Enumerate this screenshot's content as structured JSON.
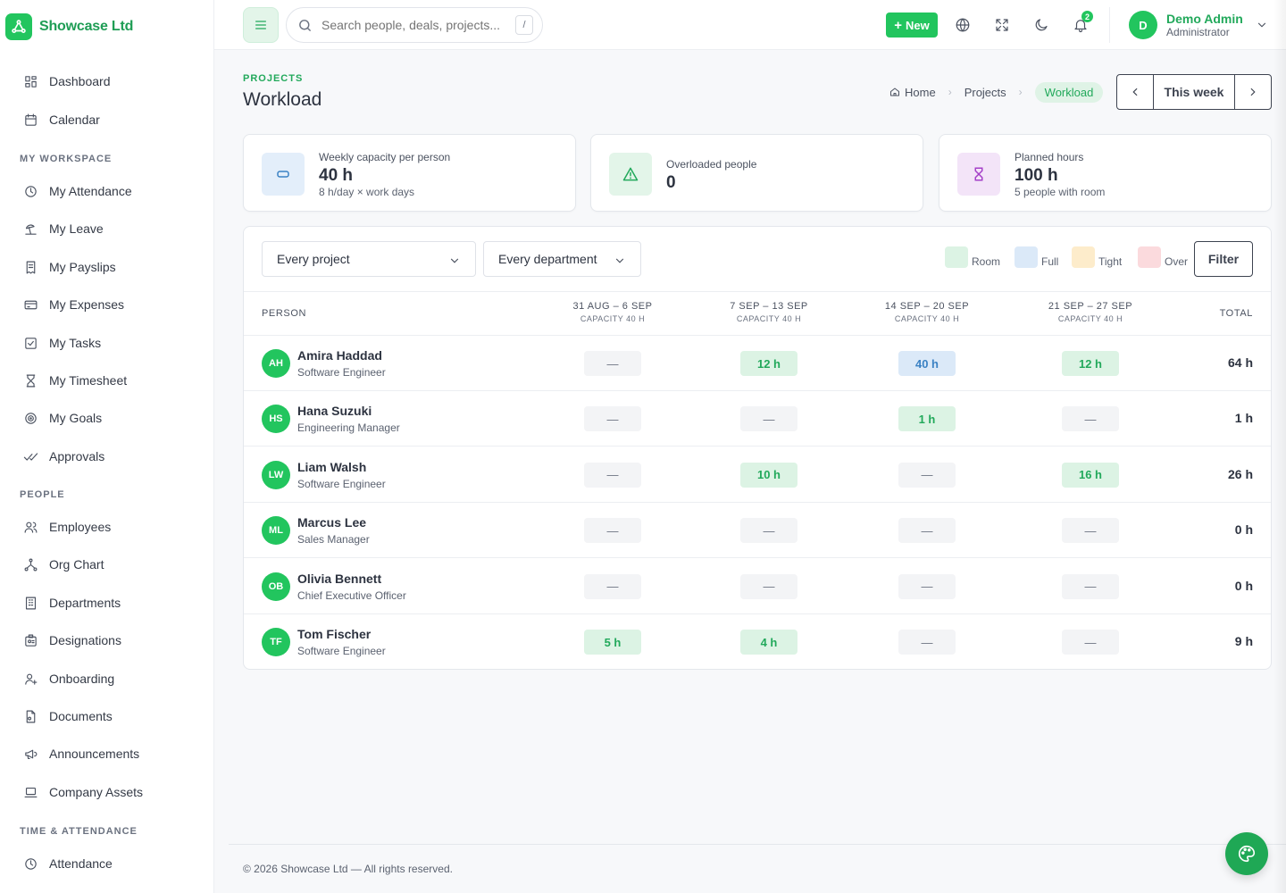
{
  "brand": {
    "name": "Showcase Ltd"
  },
  "sidebar": {
    "top_items": [
      {
        "label": "Dashboard",
        "icon": "dashboard-icon"
      },
      {
        "label": "Calendar",
        "icon": "calendar-icon"
      }
    ],
    "sections": [
      {
        "title": "MY WORKSPACE",
        "items": [
          {
            "label": "My Attendance",
            "icon": "clock-icon"
          },
          {
            "label": "My Leave",
            "icon": "beach-icon"
          },
          {
            "label": "My Payslips",
            "icon": "receipt-icon"
          },
          {
            "label": "My Expenses",
            "icon": "card-icon"
          },
          {
            "label": "My Tasks",
            "icon": "checkbox-icon"
          },
          {
            "label": "My Timesheet",
            "icon": "hourglass-icon"
          },
          {
            "label": "My Goals",
            "icon": "target-icon"
          },
          {
            "label": "Approvals",
            "icon": "double-check-icon"
          }
        ]
      },
      {
        "title": "PEOPLE",
        "items": [
          {
            "label": "Employees",
            "icon": "users-icon"
          },
          {
            "label": "Org Chart",
            "icon": "org-chart-icon"
          },
          {
            "label": "Departments",
            "icon": "building-icon"
          },
          {
            "label": "Designations",
            "icon": "id-badge-icon"
          },
          {
            "label": "Onboarding",
            "icon": "user-plus-icon"
          },
          {
            "label": "Documents",
            "icon": "document-icon"
          },
          {
            "label": "Announcements",
            "icon": "megaphone-icon"
          },
          {
            "label": "Company Assets",
            "icon": "laptop-icon"
          }
        ]
      },
      {
        "title": "TIME & ATTENDANCE",
        "items": [
          {
            "label": "Attendance",
            "icon": "clock-icon"
          }
        ]
      }
    ]
  },
  "topbar": {
    "search_placeholder": "Search people, deals, projects...",
    "search_shortcut": "/",
    "new_label": "New",
    "notifications_count": "2",
    "user": {
      "initial": "D",
      "name": "Demo Admin",
      "role": "Administrator"
    }
  },
  "page": {
    "eyebrow": "PROJECTS",
    "title": "Workload",
    "breadcrumb": {
      "home": "Home",
      "projects": "Projects",
      "current": "Workload"
    },
    "period_label": "This week"
  },
  "stats": [
    {
      "label": "Weekly capacity per person",
      "value": "40 h",
      "sub": "8 h/day × work days",
      "icon": "capacity-icon",
      "bg": "#e3eefa",
      "color": "#3b82c4"
    },
    {
      "label": "Overloaded people",
      "value": "0",
      "sub": "",
      "icon": "warning-icon",
      "bg": "#e3f5e9",
      "color": "#22a95b"
    },
    {
      "label": "Planned hours",
      "value": "100 h",
      "sub": "5 people with room",
      "icon": "hourglass-icon",
      "bg": "#f3e4f8",
      "color": "#a43fc8"
    }
  ],
  "filters": {
    "project": "Every project",
    "department": "Every department",
    "filter_label": "Filter"
  },
  "legend": [
    {
      "label": "Room",
      "color": "#dcf3e4"
    },
    {
      "label": "Full",
      "color": "#dbe9f8"
    },
    {
      "label": "Tight",
      "color": "#fdeccb"
    },
    {
      "label": "Over",
      "color": "#fbdadd"
    }
  ],
  "table": {
    "person_header": "PERSON",
    "total_header": "TOTAL",
    "weeks": [
      {
        "range": "31 AUG – 6 SEP",
        "capacity": "CAPACITY 40 H"
      },
      {
        "range": "7 SEP – 13 SEP",
        "capacity": "CAPACITY 40 H"
      },
      {
        "range": "14 SEP – 20 SEP",
        "capacity": "CAPACITY 40 H"
      },
      {
        "range": "21 SEP – 27 SEP",
        "capacity": "CAPACITY 40 H"
      }
    ],
    "rows": [
      {
        "initials": "AH",
        "name": "Amira Haddad",
        "role": "Software Engineer",
        "cells": [
          {
            "text": "—",
            "state": "empty"
          },
          {
            "text": "12 h",
            "state": "room"
          },
          {
            "text": "40 h",
            "state": "full"
          },
          {
            "text": "12 h",
            "state": "room"
          }
        ],
        "total": "64 h"
      },
      {
        "initials": "HS",
        "name": "Hana Suzuki",
        "role": "Engineering Manager",
        "cells": [
          {
            "text": "—",
            "state": "empty"
          },
          {
            "text": "—",
            "state": "empty"
          },
          {
            "text": "1 h",
            "state": "room"
          },
          {
            "text": "—",
            "state": "empty"
          }
        ],
        "total": "1 h"
      },
      {
        "initials": "LW",
        "name": "Liam Walsh",
        "role": "Software Engineer",
        "cells": [
          {
            "text": "—",
            "state": "empty"
          },
          {
            "text": "10 h",
            "state": "room"
          },
          {
            "text": "—",
            "state": "empty"
          },
          {
            "text": "16 h",
            "state": "room"
          }
        ],
        "total": "26 h"
      },
      {
        "initials": "ML",
        "name": "Marcus Lee",
        "role": "Sales Manager",
        "cells": [
          {
            "text": "—",
            "state": "empty"
          },
          {
            "text": "—",
            "state": "empty"
          },
          {
            "text": "—",
            "state": "empty"
          },
          {
            "text": "—",
            "state": "empty"
          }
        ],
        "total": "0 h"
      },
      {
        "initials": "OB",
        "name": "Olivia Bennett",
        "role": "Chief Executive Officer",
        "cells": [
          {
            "text": "—",
            "state": "empty"
          },
          {
            "text": "—",
            "state": "empty"
          },
          {
            "text": "—",
            "state": "empty"
          },
          {
            "text": "—",
            "state": "empty"
          }
        ],
        "total": "0 h"
      },
      {
        "initials": "TF",
        "name": "Tom Fischer",
        "role": "Software Engineer",
        "cells": [
          {
            "text": "5 h",
            "state": "room"
          },
          {
            "text": "4 h",
            "state": "room"
          },
          {
            "text": "—",
            "state": "empty"
          },
          {
            "text": "—",
            "state": "empty"
          }
        ],
        "total": "9 h"
      }
    ]
  },
  "footer": {
    "text": "© 2026 Showcase Ltd — All rights reserved."
  }
}
